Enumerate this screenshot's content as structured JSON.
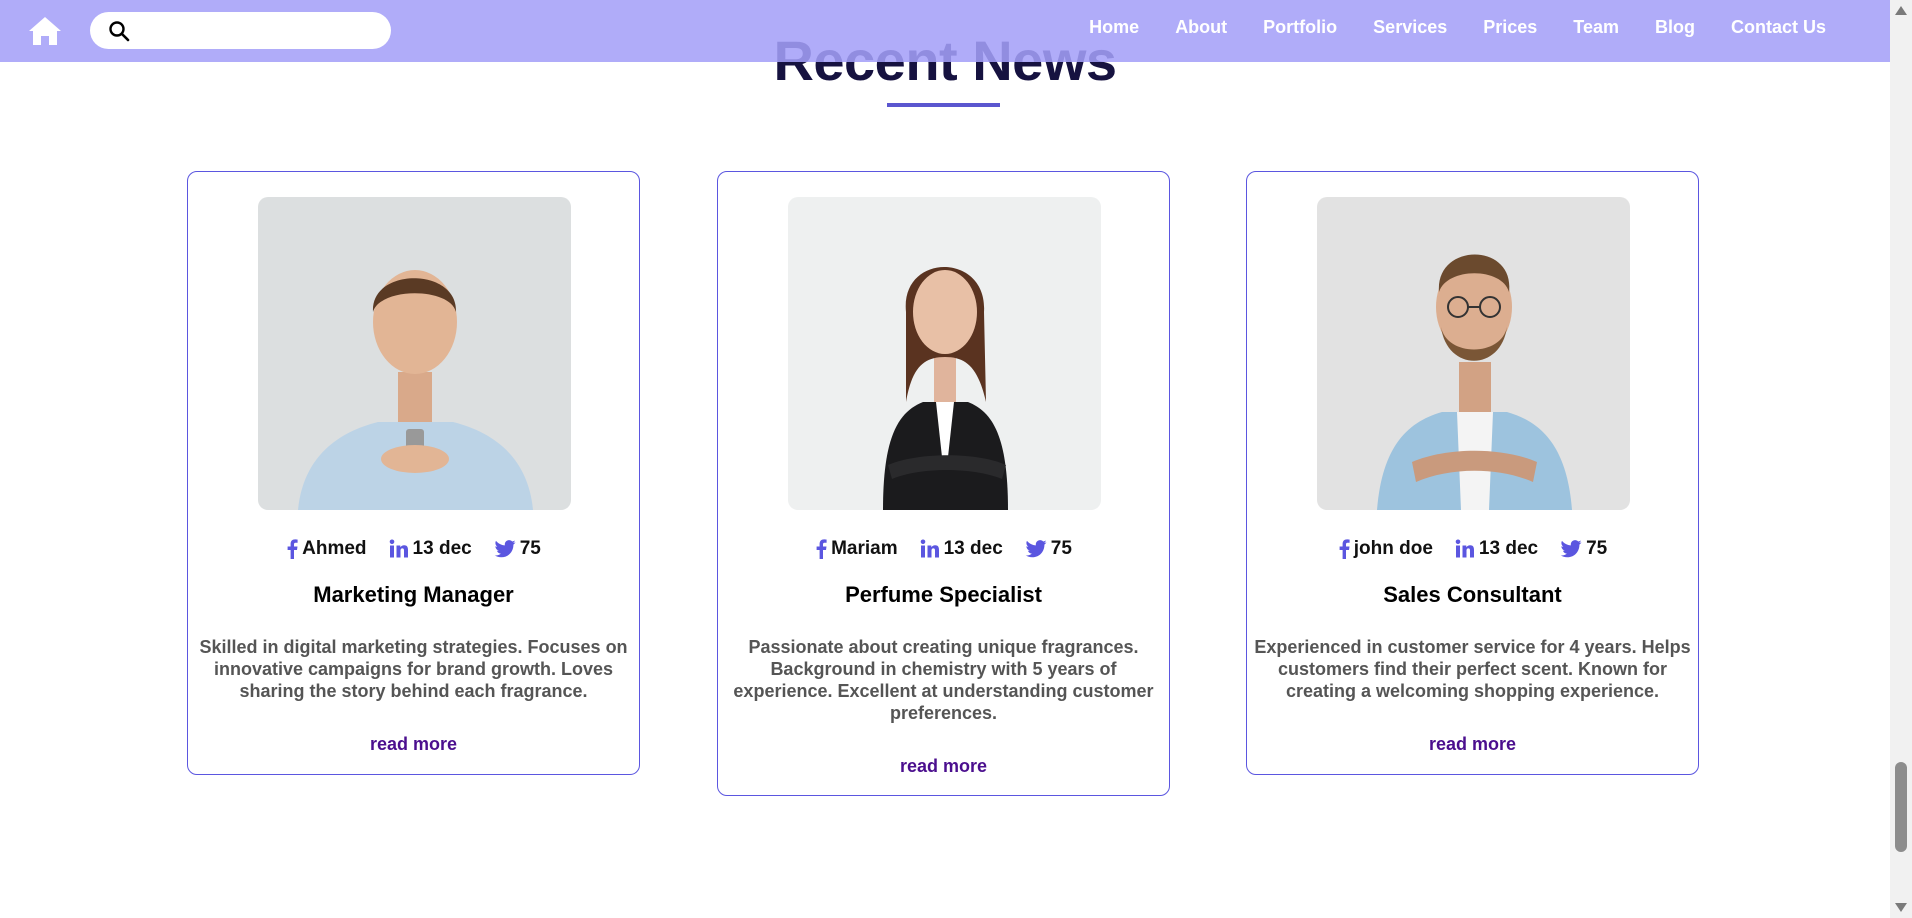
{
  "nav": {
    "search_placeholder": "",
    "links": [
      "Home",
      "About",
      "Portfolio",
      "Services",
      "Prices",
      "Team",
      "Blog",
      "Contact Us"
    ]
  },
  "section": {
    "title": "Recent News"
  },
  "cards": [
    {
      "author": "Ahmed",
      "date": "13 dec",
      "count": "75",
      "title": "Marketing Manager",
      "description": "Skilled in digital marketing strategies. Focuses on innovative campaigns for brand growth. Loves sharing the story behind each fragrance.",
      "link": "read more"
    },
    {
      "author": "Mariam",
      "date": "13 dec",
      "count": "75",
      "title": "Perfume Specialist",
      "description": "Passionate about creating unique fragrances. Background in chemistry with 5 years of experience. Excellent at understanding customer preferences.",
      "link": "read more"
    },
    {
      "author": "john doe",
      "date": "13 dec",
      "count": "75",
      "title": "Sales Consultant",
      "description": "Experienced in customer service for 4 years. Helps customers find their perfect scent. Known for creating a welcoming shopping experience.",
      "link": "read more"
    }
  ],
  "colors": {
    "navbar": "#a4a0f8",
    "accent": "#5b56e0",
    "link": "#4b0f8e",
    "heading": "#161240"
  }
}
